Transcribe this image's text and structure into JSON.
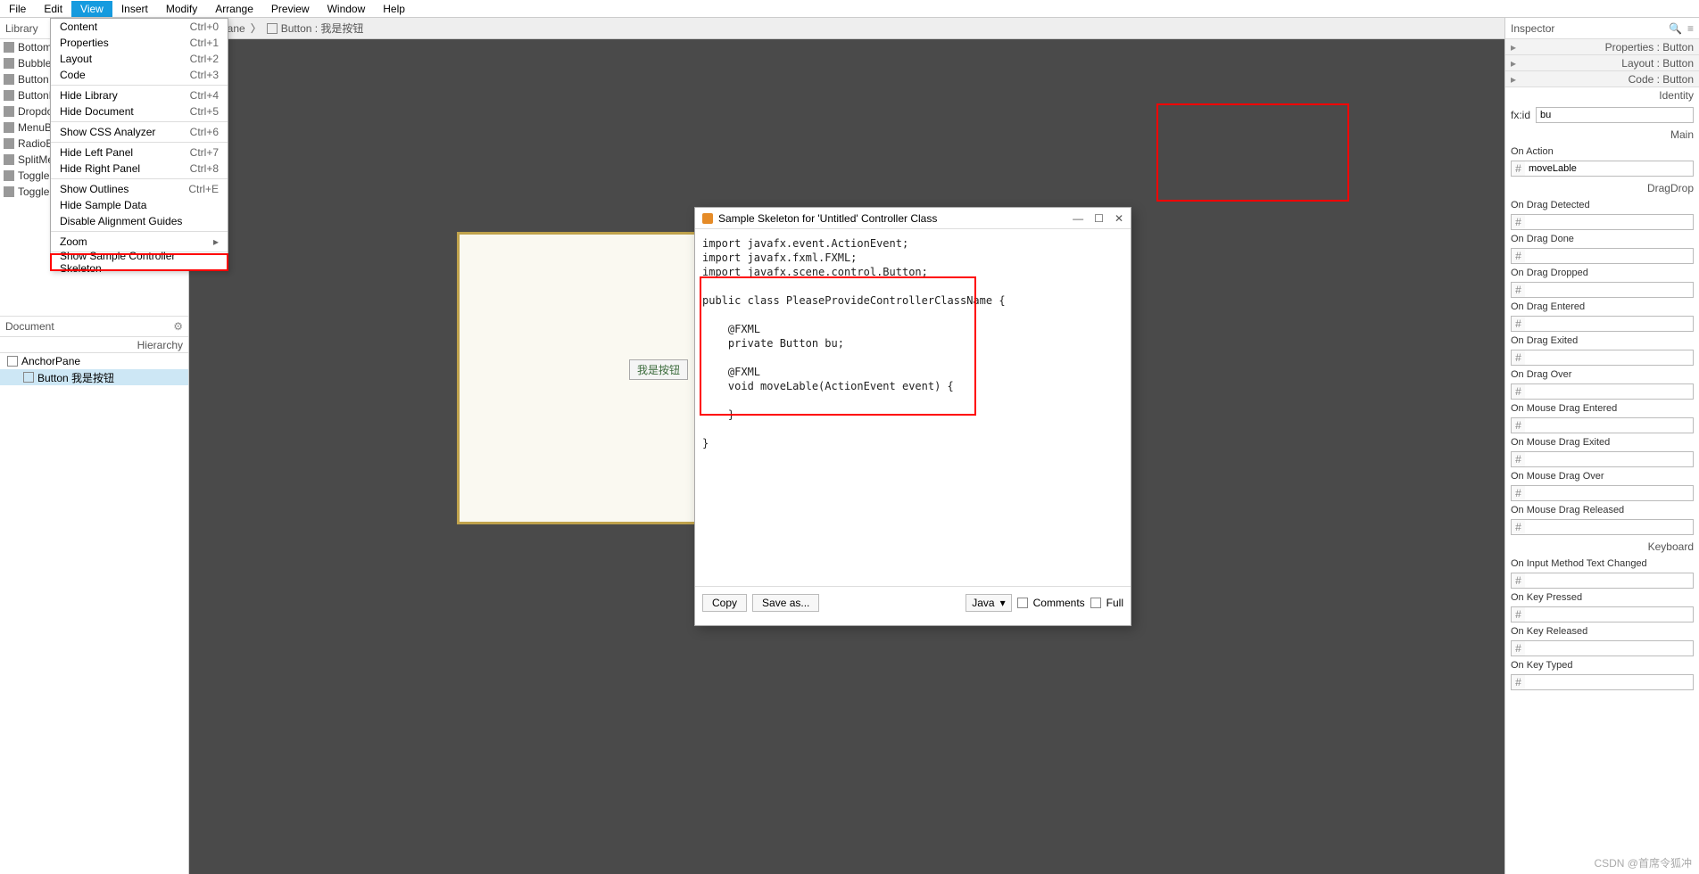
{
  "menubar": [
    "File",
    "Edit",
    "View",
    "Insert",
    "Modify",
    "Arrange",
    "Preview",
    "Window",
    "Help"
  ],
  "menubar_active_index": 2,
  "view_menu": [
    {
      "label": "Content",
      "accel": "Ctrl+0"
    },
    {
      "label": "Properties",
      "accel": "Ctrl+1"
    },
    {
      "label": "Layout",
      "accel": "Ctrl+2"
    },
    {
      "label": "Code",
      "accel": "Ctrl+3"
    },
    {
      "sep": true
    },
    {
      "label": "Hide Library",
      "accel": "Ctrl+4"
    },
    {
      "label": "Hide Document",
      "accel": "Ctrl+5"
    },
    {
      "sep": true
    },
    {
      "label": "Show CSS Analyzer",
      "accel": "Ctrl+6"
    },
    {
      "sep": true
    },
    {
      "label": "Hide Left Panel",
      "accel": "Ctrl+7"
    },
    {
      "label": "Hide Right Panel",
      "accel": "Ctrl+8"
    },
    {
      "sep": true
    },
    {
      "label": "Show Outlines",
      "accel": "Ctrl+E"
    },
    {
      "label": "Hide Sample Data",
      "accel": ""
    },
    {
      "label": "Disable Alignment Guides",
      "accel": ""
    },
    {
      "sep": true
    },
    {
      "label": "Zoom",
      "accel": "",
      "submenu": true
    },
    {
      "sep": true
    },
    {
      "label": "Show Sample Controller Skeleton",
      "accel": "",
      "highlight": true
    }
  ],
  "library": {
    "title": "Library",
    "items": [
      "BottomNa",
      "BubbleCh",
      "Button",
      "ButtonBa",
      "Dropdown",
      "MenuButt",
      "RadioBut",
      "SplitMen",
      "ToggleBu",
      "ToggleBu"
    ]
  },
  "document": {
    "title": "Document",
    "subhead": "Hierarchy",
    "tree": [
      {
        "label": "AnchorPane",
        "indent": 0,
        "selected": false
      },
      {
        "label": "Button  我是按钮",
        "indent": 1,
        "selected": true
      }
    ]
  },
  "breadcrumb": {
    "root": "orPane",
    "child": "Button : 我是按钮"
  },
  "canvas": {
    "button_label": "我是按钮"
  },
  "inspector": {
    "title": "Inspector",
    "sections": [
      {
        "label": "Properties : Button"
      },
      {
        "label": "Layout : Button"
      },
      {
        "label": "Code : Button"
      }
    ],
    "identity_label": "Identity",
    "fxid_label": "fx:id",
    "fxid_value": "bu",
    "main_label": "Main",
    "on_action_label": "On Action",
    "on_action_value": "moveLable",
    "dragdrop_label": "DragDrop",
    "drag_events": [
      "On Drag Detected",
      "On Drag Done",
      "On Drag Dropped",
      "On Drag Entered",
      "On Drag Exited",
      "On Drag Over",
      "On Mouse Drag Entered",
      "On Mouse Drag Exited",
      "On Mouse Drag Over",
      "On Mouse Drag Released"
    ],
    "keyboard_label": "Keyboard",
    "key_events": [
      "On Input Method Text Changed",
      "On Key Pressed",
      "On Key Released",
      "On Key Typed"
    ]
  },
  "dialog": {
    "title": "Sample Skeleton for 'Untitled' Controller Class",
    "code": "import javafx.event.ActionEvent;\nimport javafx.fxml.FXML;\nimport javafx.scene.control.Button;\n\npublic class PleaseProvideControllerClassName {\n\n    @FXML\n    private Button bu;\n\n    @FXML\n    void moveLable(ActionEvent event) {\n\n    }\n\n}",
    "copy": "Copy",
    "saveas": "Save as...",
    "lang": "Java",
    "comments": "Comments",
    "full": "Full"
  },
  "watermark": "CSDN @首席令狐冲"
}
